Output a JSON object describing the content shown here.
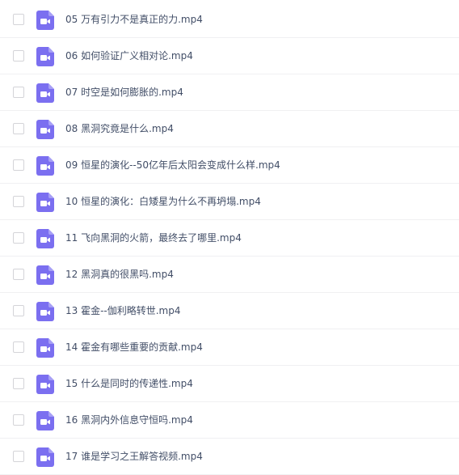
{
  "file_list": {
    "icon": "video-file-icon",
    "icon_color": "#7b6ff0",
    "items": [
      {
        "name": "05 万有引力不是真正的力.mp4"
      },
      {
        "name": "06 如何验证广义相对论.mp4"
      },
      {
        "name": "07 时空是如何膨胀的.mp4"
      },
      {
        "name": "08 黑洞究竟是什么.mp4"
      },
      {
        "name": "09 恒星的演化--50亿年后太阳会变成什么样.mp4"
      },
      {
        "name": "10 恒星的演化：白矮星为什么不再坍塌.mp4"
      },
      {
        "name": "11 飞向黑洞的火箭，最终去了哪里.mp4"
      },
      {
        "name": "12 黑洞真的很黑吗.mp4"
      },
      {
        "name": "13 霍金--伽利略转世.mp4"
      },
      {
        "name": "14 霍金有哪些重要的贡献.mp4"
      },
      {
        "name": "15 什么是同时的传递性.mp4"
      },
      {
        "name": "16 黑洞内外信息守恒吗.mp4"
      },
      {
        "name": "17 谁是学习之王解答视频.mp4"
      }
    ]
  }
}
